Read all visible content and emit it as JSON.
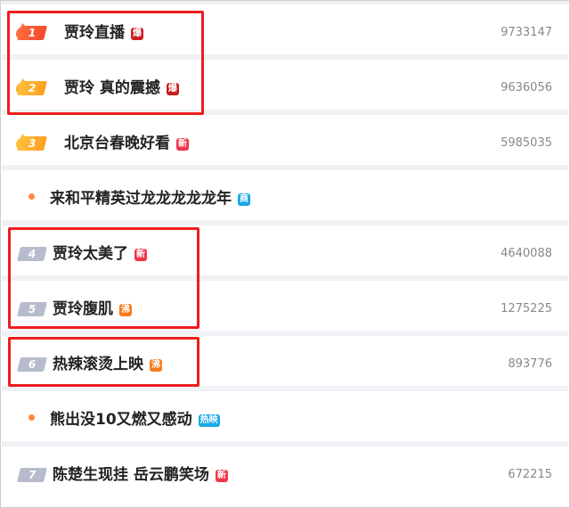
{
  "colors": {
    "baozha": "#c91c1c",
    "xin": "#f0364b",
    "fei": "#f77c1c",
    "shang": "#1aa8e6",
    "reying": "#1aa8e6",
    "annotation": "#ee1d1d"
  },
  "items": [
    {
      "rank": "1",
      "title": "贾玲直播",
      "badge": "爆",
      "count": "9733147",
      "style": "hot",
      "icon": "flame-icon"
    },
    {
      "rank": "2",
      "title": "贾玲 真的震撼",
      "badge": "爆",
      "count": "9636056",
      "style": "gold",
      "icon": "flame-icon"
    },
    {
      "rank": "3",
      "title": "北京台春晚好看",
      "badge": "新",
      "count": "5985035",
      "style": "gold",
      "icon": "flame-icon"
    },
    {
      "rank": "",
      "title": "来和平精英过龙龙龙龙龙年",
      "badge": "商",
      "count": "",
      "style": "dot",
      "icon": "dot-icon"
    },
    {
      "rank": "4",
      "title": "贾玲太美了",
      "badge": "新",
      "count": "4640088",
      "style": "grey",
      "icon": ""
    },
    {
      "rank": "5",
      "title": "贾玲腹肌",
      "badge": "沸",
      "count": "1275225",
      "style": "grey",
      "icon": ""
    },
    {
      "rank": "6",
      "title": "热辣滚烫上映",
      "badge": "沸",
      "count": "893776",
      "style": "grey",
      "icon": ""
    },
    {
      "rank": "",
      "title": "熊出没10又燃又感动",
      "badge": "热映",
      "count": "",
      "style": "dot",
      "icon": "dot-icon"
    },
    {
      "rank": "7",
      "title": "陈楚生现挂 岳云鹏笑场",
      "badge": "新",
      "count": "672215",
      "style": "grey",
      "icon": ""
    }
  ]
}
